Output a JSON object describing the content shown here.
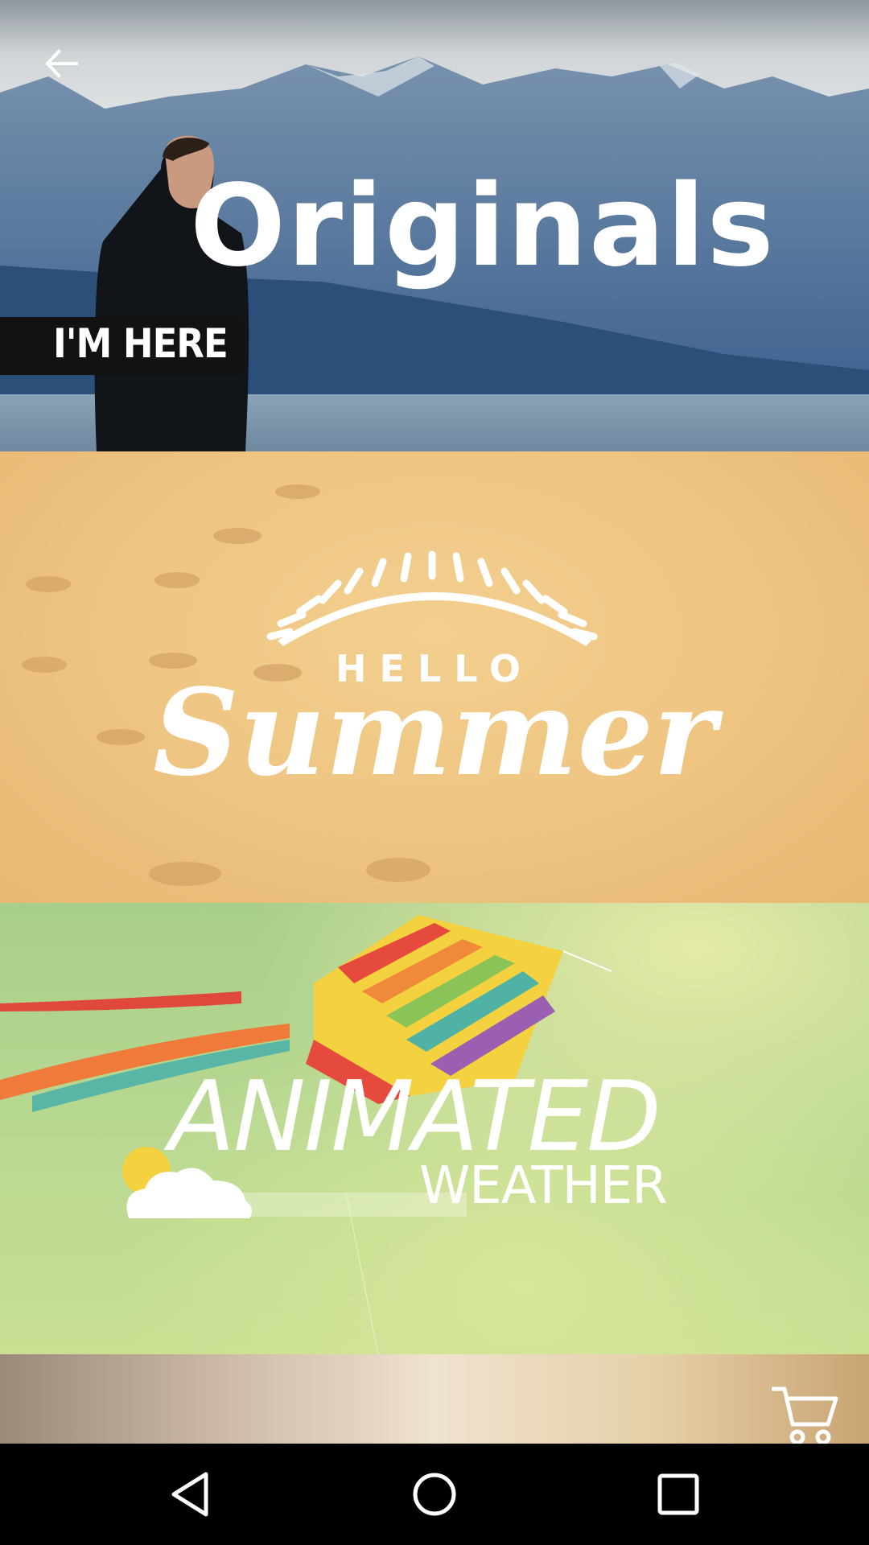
{
  "header": {
    "back_icon": "arrow-left-icon"
  },
  "cards": [
    {
      "title": "Originals",
      "tagline": "I'M HERE"
    },
    {
      "title_top": "HELLO",
      "title_main": "Summer"
    },
    {
      "title_top": "ANIMATED",
      "title_bottom": "WEATHER"
    }
  ],
  "cart": {
    "icon": "cart-icon"
  },
  "system_nav": {
    "back_icon": "triangle-back-icon",
    "home_icon": "circle-home-icon",
    "recents_icon": "square-recents-icon"
  },
  "colors": {
    "sand": "#efc683",
    "grass": "#b8d891",
    "lake": "#6d8aa8",
    "tagline_bar": "#121212"
  }
}
